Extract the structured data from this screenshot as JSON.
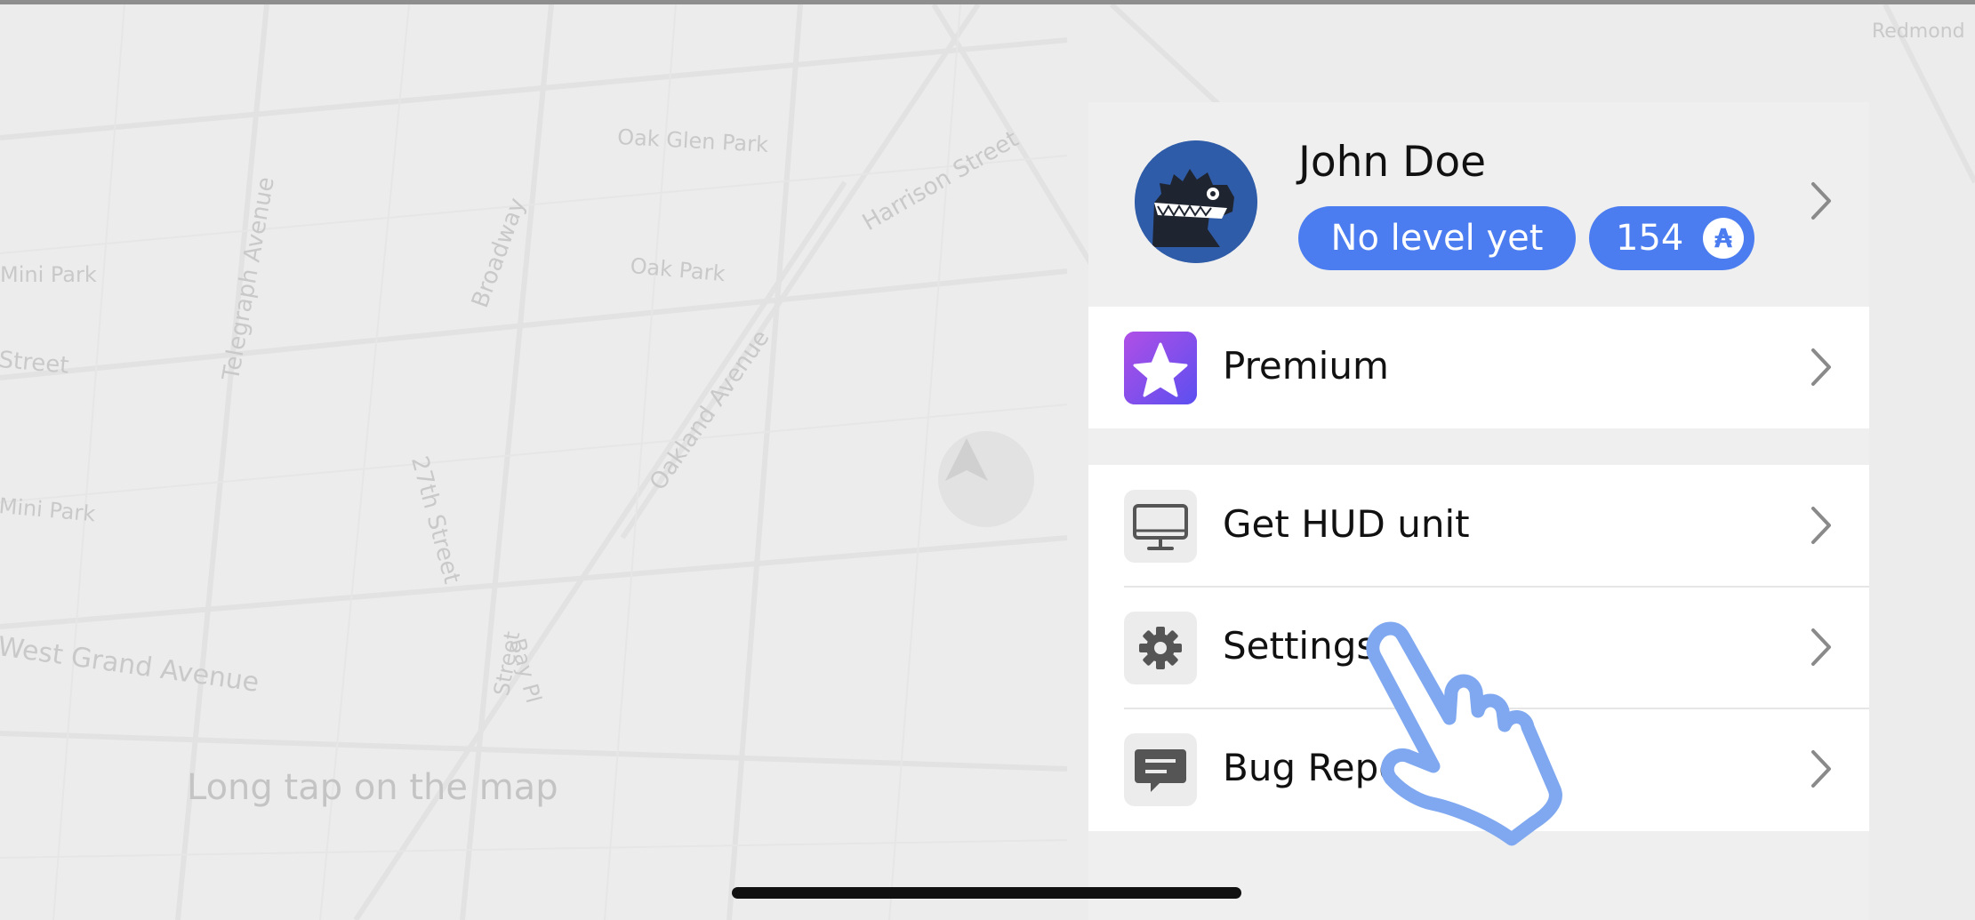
{
  "map": {
    "streets": [
      "Oak Glen Park",
      "Harrison Street",
      "Telegraph Avenue",
      "Broadway",
      "Oak Park",
      "Mini Park",
      "Street",
      "Oakland Avenue",
      "27th Street",
      "Mini Park",
      "West Grand Avenue",
      "Street",
      "Bay Pl",
      "Redmond"
    ],
    "hint": "Long tap on the map"
  },
  "profile": {
    "name": "John Doe",
    "level": "No level yet",
    "coins": "154",
    "coin_symbol": "₳"
  },
  "menu": {
    "premium": "Premium",
    "hud": "Get HUD unit",
    "settings": "Settings",
    "bug_report": "Bug Report"
  },
  "colors": {
    "accent": "#4b7df0",
    "premium_icon": "#8b4de8",
    "hand_outline": "#7fa8f0"
  },
  "icons": [
    "avatar-monster-icon",
    "coin-icon",
    "star-icon",
    "monitor-icon",
    "gear-icon",
    "chat-bubble-icon",
    "chevron-right-icon",
    "locate-arrow-icon",
    "pointing-hand-icon"
  ]
}
